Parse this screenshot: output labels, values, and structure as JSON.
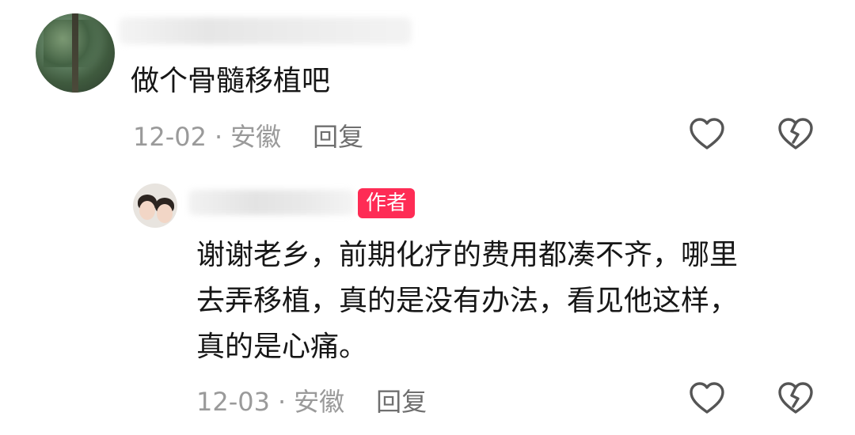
{
  "comments": [
    {
      "text": "做个骨髓移植吧",
      "date": "12-02",
      "location": "安徽",
      "reply_label": "回复",
      "like_icon": "heart-outline-icon",
      "dislike_icon": "broken-heart-icon"
    },
    {
      "badge": "作者",
      "text_lines": [
        "谢谢老乡，前期化疗的费用都凑不齐，哪里",
        "去弄移植，真的是没有办法，看见他这样，",
        "真的是心痛。"
      ],
      "date": "12-03",
      "location": "安徽",
      "reply_label": "回复",
      "like_icon": "heart-outline-icon",
      "dislike_icon": "broken-heart-icon"
    }
  ],
  "meta_separator": "·",
  "colors": {
    "author_badge": "#fe2c55",
    "meta_text": "#9a9a9a",
    "icon_stroke": "#555555"
  }
}
